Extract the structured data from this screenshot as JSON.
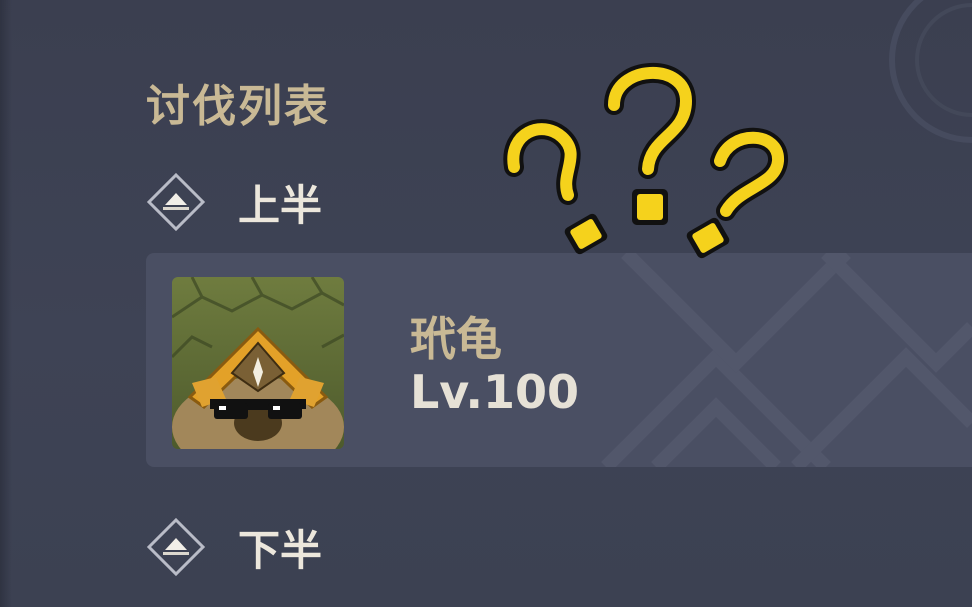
{
  "boss_list": {
    "title": "讨伐列表",
    "groups": [
      {
        "label": "上半",
        "bosses": [
          {
            "name": "玳龟",
            "level": "Lv.100",
            "portrait_icon": "turtle-boss-with-sunglasses"
          }
        ]
      },
      {
        "label": "下半",
        "bosses": []
      }
    ]
  },
  "overlay": {
    "icon": "question-marks-icon",
    "color": "#f5d21c",
    "outline": "#111111"
  },
  "colors": {
    "background": "#3d4253",
    "card": "#4a4f63",
    "title_gold": "#c9b995",
    "text_light": "#ece7dc"
  }
}
